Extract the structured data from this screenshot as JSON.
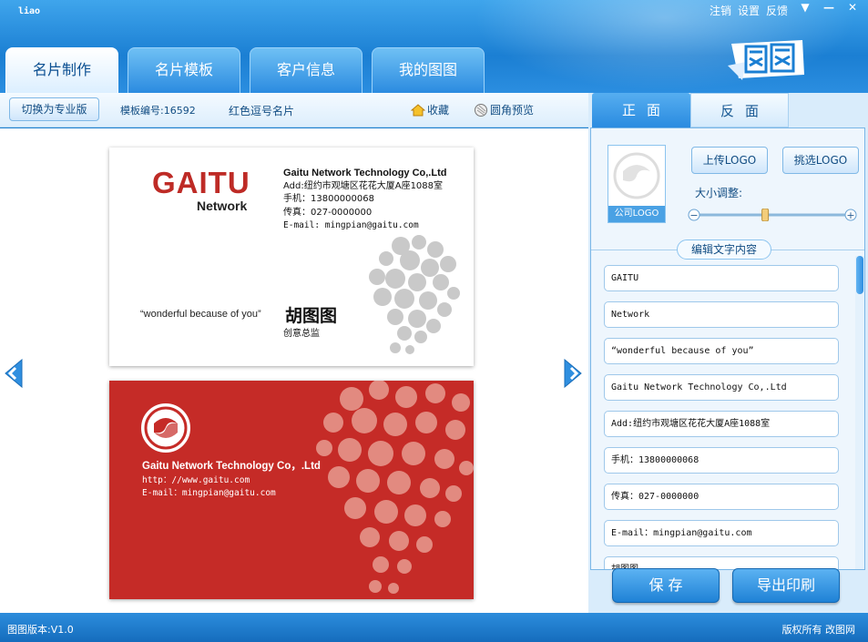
{
  "header": {
    "user": "liao",
    "links": [
      "注销",
      "设置",
      "反馈"
    ],
    "window_buttons": [
      "minimize",
      "close"
    ],
    "tabs": [
      "名片制作",
      "名片模板",
      "客户信息",
      "我的图图"
    ],
    "active_tab": 0,
    "brand": "图图"
  },
  "toolbar": {
    "switch_pro": "切换为专业版",
    "template_no": "模板编号:16592",
    "template_name": "红色逗号名片",
    "favorite": "收藏",
    "round_preview": "圆角预览"
  },
  "card_front": {
    "brand": "GAITU",
    "sub": "Network",
    "company": "Gaitu Network Technology Co,.Ltd",
    "address": "Add:纽约市观塘区花花大厦A座1088室",
    "phone": "手机：13800000068",
    "fax": "传真：027-0000000",
    "email": "E-mail: mingpian@gaitu.com",
    "slogan": "“wonderful because of you”",
    "name": "胡图图",
    "title": "创意总监"
  },
  "card_back": {
    "company": "Gaitu Network Technology Co，.Ltd",
    "http": "http：//www.gaitu.com",
    "email": "E-mail：mingpian@gaitu.com"
  },
  "side": {
    "tab_front": "正面",
    "tab_back": "反面",
    "logo_label": "公司LOGO",
    "upload_logo": "上传LOGO",
    "pick_logo": "挑选LOGO",
    "size_label": "大小调整:",
    "size_value": 0.45,
    "edit_label": "编辑文字内容",
    "fields": [
      "GAITU",
      "Network",
      "“wonderful because of you”",
      "Gaitu Network Technology Co,.Ltd",
      "Add:纽约市观塘区花花大厦A座1088室",
      "手机：13800000068",
      "传真：027-0000000",
      "E-mail：mingpian@gaitu.com",
      "胡图图"
    ],
    "save": "保 存",
    "export": "导出印刷"
  },
  "status": {
    "version": "图图版本:V1.0",
    "copyright": "版权所有 改图网"
  },
  "colors": {
    "accent": "#1d7fce",
    "card_red": "#c52b27",
    "brand_red": "#be2b26"
  }
}
